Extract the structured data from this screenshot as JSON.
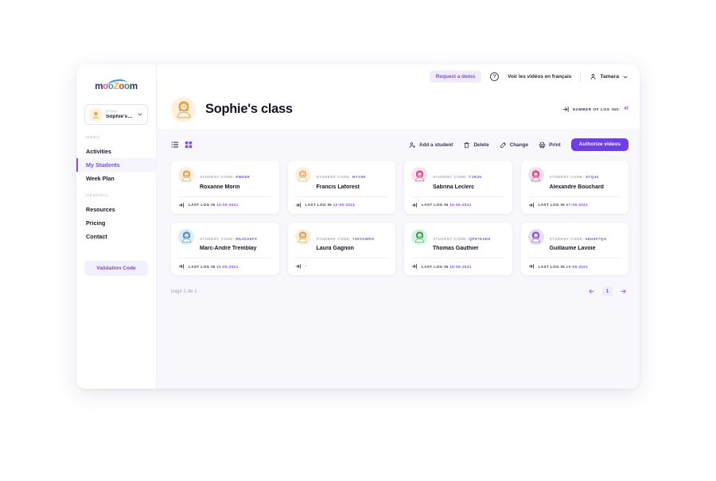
{
  "sidebar": {
    "logo": {
      "part1": "m",
      "part2": "o",
      "part3": "o",
      "part4": "Z",
      "part5": "o",
      "part6": "o",
      "part7": "m"
    },
    "group_picker": {
      "label": "Group",
      "value": "Sophie's cl...",
      "chevron": "chevron-down-icon"
    },
    "sections": [
      {
        "title": "MENU",
        "items": [
          {
            "label": "Activities",
            "active": false
          },
          {
            "label": "My Students",
            "active": true
          },
          {
            "label": "Week Plan",
            "active": false
          }
        ]
      },
      {
        "title": "GÉNÉRAL",
        "items": [
          {
            "label": "Resources",
            "active": false
          },
          {
            "label": "Pricing",
            "active": false
          },
          {
            "label": "Contact",
            "active": false
          }
        ]
      }
    ],
    "validation_button": "Validation Code"
  },
  "topbar": {
    "demo_button": "Request a demo",
    "help_icon": "?",
    "language_link": "Voir les vidéos en français",
    "user_name": "Tamara"
  },
  "page_head": {
    "title": "Sophie's class",
    "logins_label": "NUMBER OF LOG INS:",
    "logins_count": "47"
  },
  "toolbar": {
    "view_list": "list-view-icon",
    "view_grid": "grid-view-icon",
    "actions": [
      {
        "label": "Add a student",
        "icon": "add-user-icon"
      },
      {
        "label": "Delete",
        "icon": "trash-icon"
      },
      {
        "label": "Change",
        "icon": "edit-icon"
      },
      {
        "label": "Print",
        "icon": "printer-icon"
      }
    ],
    "primary_action": "Authorize videos"
  },
  "students": {
    "code_label": "STUDENT CODE:",
    "login_label": "LAST LOG IN",
    "list": [
      {
        "name": "Roxanne Morin",
        "code": "PMD68",
        "last_login": "14-05-2021",
        "avatar_bg": "#fbeede",
        "avatar_color": "#e0a653",
        "hair": "#e0a653"
      },
      {
        "name": "Francis Laforest",
        "code": "RYY85",
        "last_login": "12-05-2021",
        "avatar_bg": "#fbeede",
        "avatar_color": "#e0a653",
        "hair": "#e8b96a"
      },
      {
        "name": "Sabrina Leclerc",
        "code": "TJR35",
        "last_login": "15-05-2021",
        "avatar_bg": "#fde3f0",
        "avatar_color": "#e8449b",
        "hair": "#e8449b"
      },
      {
        "name": "Alexandre Bouchard",
        "code": "STQ44",
        "last_login": "07-05-2021",
        "avatar_bg": "#fbdcec",
        "avatar_color": "#d9428e",
        "hair": "#d9428e"
      },
      {
        "name": "Marc-André Tremblay",
        "code": "R5JGX6FX",
        "last_login": "15-05-2021",
        "avatar_bg": "#dbecfb",
        "avatar_color": "#4a90d9",
        "hair": "#4a90d9"
      },
      {
        "name": "Laura Gagnon",
        "code": "739YAWRS",
        "last_login": "-",
        "avatar_bg": "#fbeede",
        "avatar_color": "#e0a653",
        "hair": "#e0a653"
      },
      {
        "name": "Thomas Gauthier",
        "code": "QP97K3D5",
        "last_login": "15-05-2021",
        "avatar_bg": "#d9f2e2",
        "avatar_color": "#34a85d",
        "hair": "#34a85d"
      },
      {
        "name": "Guillaume Lavoie",
        "code": "58U3F7QG",
        "last_login": "15-05-2021",
        "avatar_bg": "#e7ddfb",
        "avatar_color": "#8257e0",
        "hair": "#8257e0"
      }
    ]
  },
  "pager": {
    "text": "page 1 de 1",
    "prev": "arrow-left-icon",
    "current": "1",
    "next": "arrow-right-icon"
  },
  "colors": {
    "accent": "#7c4df0",
    "primary_button": "#6c3fe8",
    "content_bg": "#f8f7fc"
  }
}
